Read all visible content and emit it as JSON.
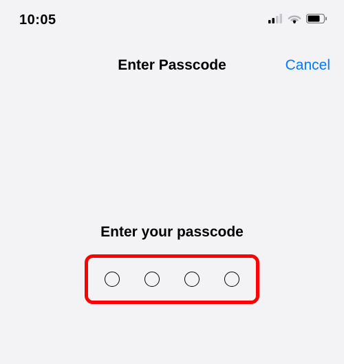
{
  "statusbar": {
    "time": "10:05"
  },
  "nav": {
    "title": "Enter Passcode",
    "cancel": "Cancel"
  },
  "content": {
    "prompt": "Enter your passcode",
    "passcode_length": 4
  },
  "colors": {
    "accent": "#007aff",
    "highlight": "#ff0000"
  }
}
